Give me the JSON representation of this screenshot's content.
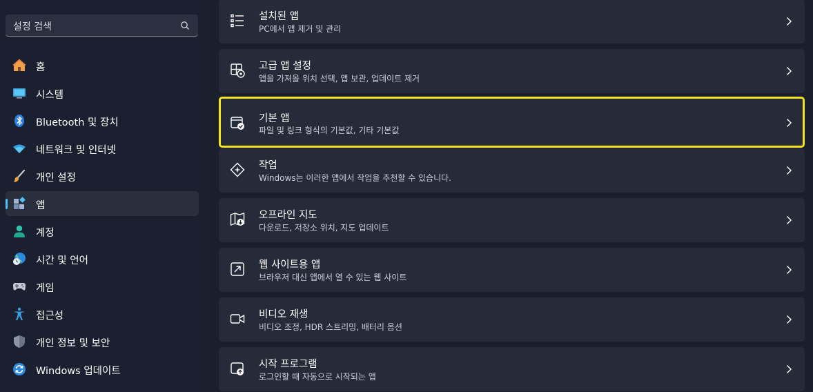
{
  "search": {
    "placeholder": "설정 검색"
  },
  "sidebar": {
    "items": [
      {
        "label": "홈",
        "icon": "home-icon"
      },
      {
        "label": "시스템",
        "icon": "system-icon"
      },
      {
        "label": "Bluetooth 및 장치",
        "icon": "bluetooth-icon"
      },
      {
        "label": "네트워크 및 인터넷",
        "icon": "wifi-icon"
      },
      {
        "label": "개인 설정",
        "icon": "brush-icon"
      },
      {
        "label": "앱",
        "icon": "apps-icon",
        "active": true
      },
      {
        "label": "계정",
        "icon": "account-icon"
      },
      {
        "label": "시간 및 언어",
        "icon": "globe-clock-icon"
      },
      {
        "label": "게임",
        "icon": "gamepad-icon"
      },
      {
        "label": "접근성",
        "icon": "accessibility-icon"
      },
      {
        "label": "개인 정보 및 보안",
        "icon": "shield-icon"
      },
      {
        "label": "Windows 업데이트",
        "icon": "update-icon"
      }
    ]
  },
  "cards": [
    {
      "title": "설치된 앱",
      "subtitle": "PC에서 앱 제거 및 관리",
      "icon": "list-icon"
    },
    {
      "title": "고급 앱 설정",
      "subtitle": "앱을 가져올 위치 선택, 앱 보관, 업데이트 제거",
      "icon": "app-settings-icon"
    },
    {
      "title": "기본 앱",
      "subtitle": "파일 및 링크 형식의 기본값, 기타 기본값",
      "icon": "default-apps-icon",
      "highlighted": true
    },
    {
      "title": "작업",
      "subtitle": "Windows는 이러한 앱에서 작업을 추천할 수 있습니다.",
      "icon": "actions-icon"
    },
    {
      "title": "오프라인 지도",
      "subtitle": "다운로드, 저장소 위치, 지도 업데이트",
      "icon": "map-icon"
    },
    {
      "title": "웹 사이트용 앱",
      "subtitle": "브라우저 대신 앱에서 열 수 있는 웹 사이트",
      "icon": "open-external-icon"
    },
    {
      "title": "비디오 재생",
      "subtitle": "비디오 조정, HDR 스트리밍, 배터리 옵션",
      "icon": "video-icon"
    },
    {
      "title": "시작 프로그램",
      "subtitle": "로그인할 때 자동으로 시작되는 앱",
      "icon": "startup-icon"
    }
  ],
  "colors": {
    "accent": "#4cc2ff",
    "highlight": "#f5e51c",
    "card": "#262b3a",
    "background": "#1a1f2e"
  }
}
